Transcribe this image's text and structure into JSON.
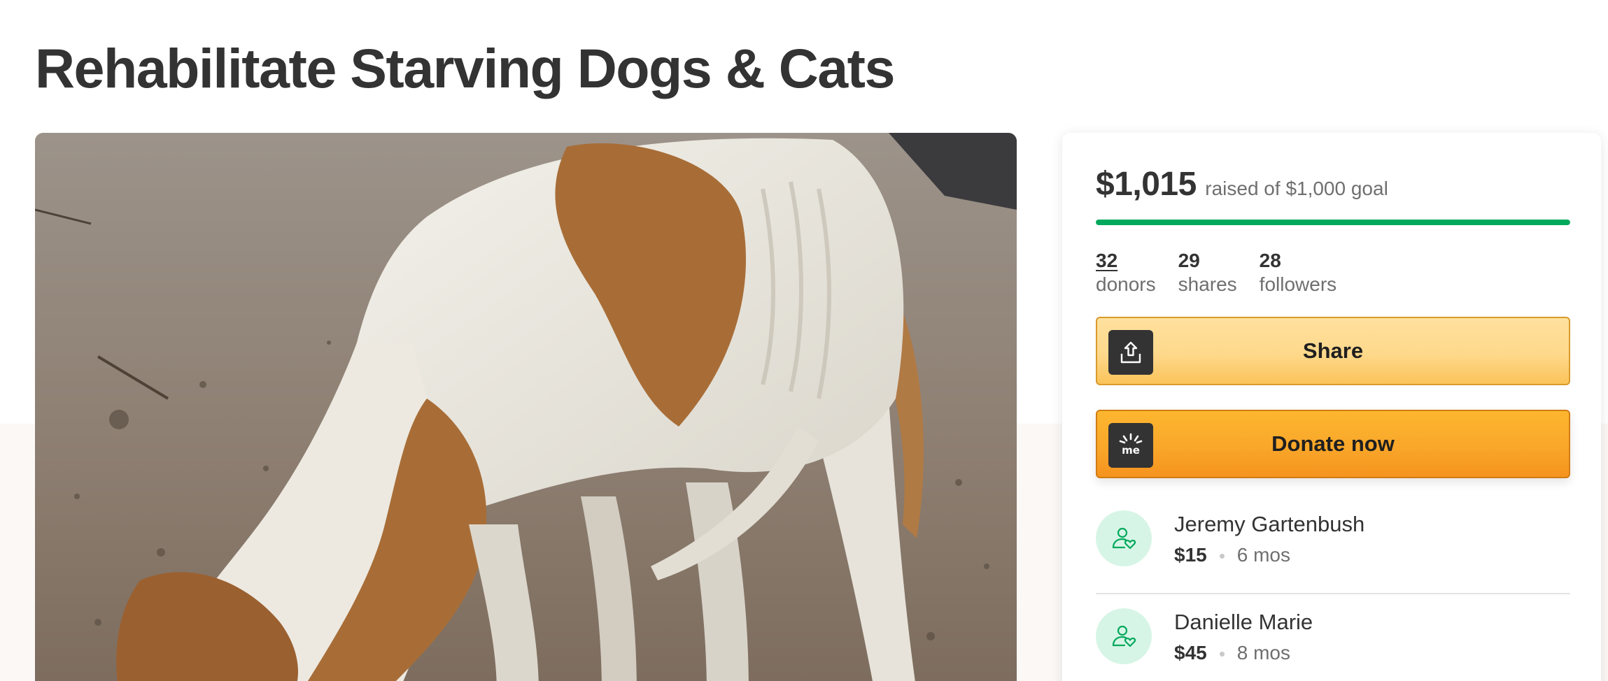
{
  "page": {
    "title": "Rehabilitate Starving Dogs & Cats"
  },
  "hero": {
    "image_subject": "emaciated-dog-photo"
  },
  "card": {
    "amount_raised": "$1,015",
    "goal_text": "raised of $1,000 goal",
    "progress_percent": 100,
    "stats": [
      {
        "value": "32",
        "label": "donors"
      },
      {
        "value": "29",
        "label": "shares"
      },
      {
        "value": "28",
        "label": "followers"
      }
    ],
    "share_button": {
      "label": "Share",
      "icon": "share-upload-icon"
    },
    "donate_button": {
      "label": "Donate now",
      "icon": "gofundme-logo-icon"
    },
    "donations": [
      {
        "name": "Jeremy Gartenbush",
        "amount": "$15",
        "time": "6 mos",
        "icon": "donor-heart-icon"
      },
      {
        "name": "Danielle Marie",
        "amount": "$45",
        "time": "8 mos",
        "icon": "donor-heart-icon"
      }
    ]
  },
  "colors": {
    "progress": "#02a95c",
    "share_button": "#fed98b",
    "donate_button": "#f9a72a",
    "avatar_bg": "#d7f5e6",
    "title_text": "#333333"
  }
}
